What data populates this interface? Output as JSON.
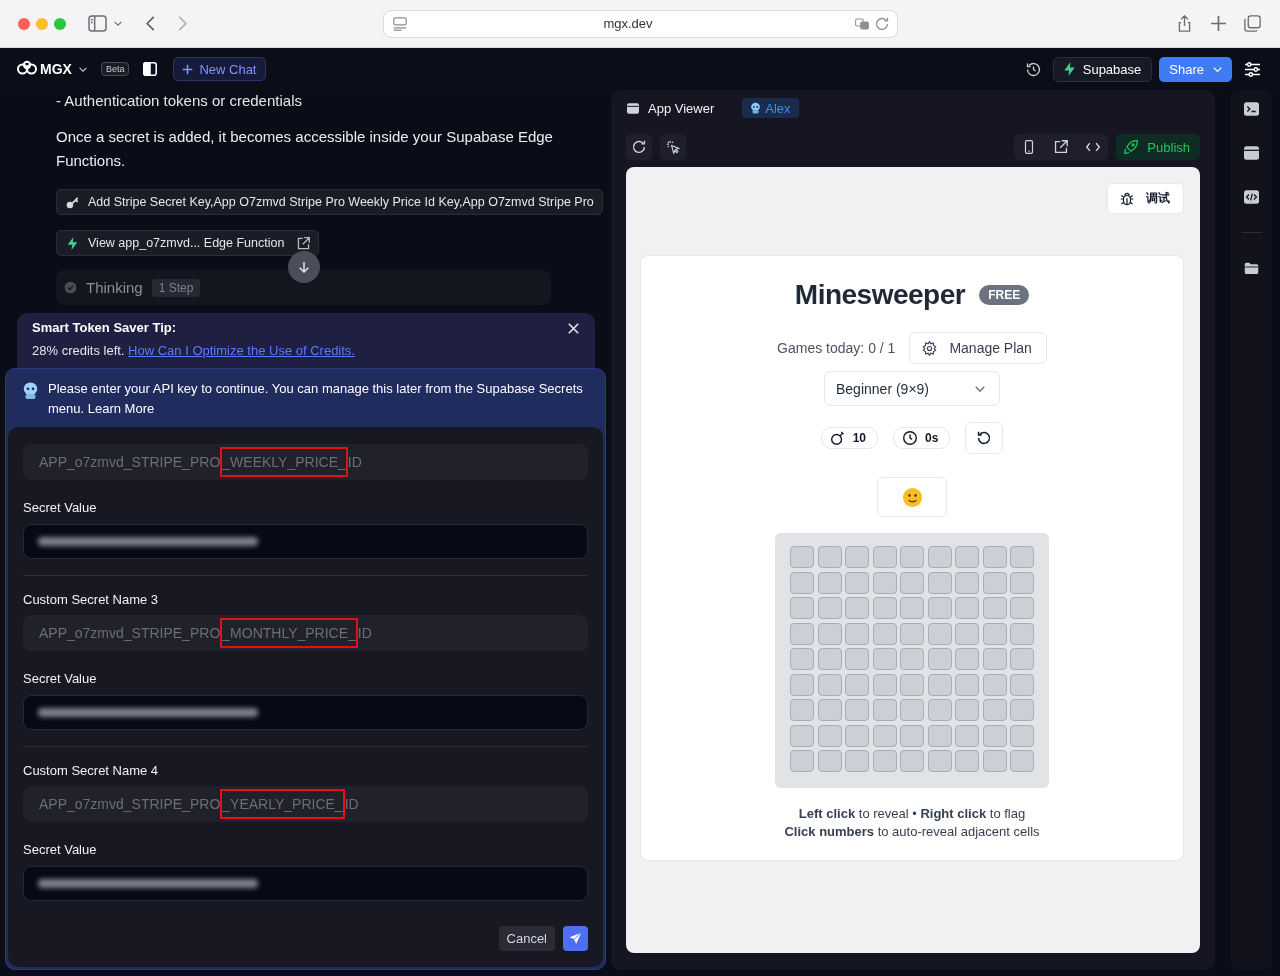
{
  "browser": {
    "url": "mgx.dev"
  },
  "header": {
    "logo": "MGX",
    "badge": "Beta",
    "new_chat": "New Chat",
    "supabase": "Supabase",
    "share": "Share"
  },
  "chat": {
    "clipped_line": "- Authentication tokens or credentials",
    "paragraph": "Once a secret is added, it becomes accessible inside your Supabase Edge Functions.",
    "actions": [
      {
        "kind": "secret",
        "label": "Add Stripe Secret Key,App O7zmvd Stripe Pro Weekly Price Id Key,App O7zmvd Stripe Pro"
      },
      {
        "kind": "function",
        "label": "View app_o7zmvd... Edge Function"
      }
    ],
    "thinking": {
      "label": "Thinking",
      "steps": "1 Step"
    }
  },
  "tip": {
    "title": "Smart Token Saver Tip:",
    "text": "28% credits left.",
    "link": "How Can I Optimize the Use of Credits."
  },
  "secrets_form": {
    "message": "Please enter your API key to continue. You can manage this later from the Supabase Secrets menu.",
    "link": "Learn More",
    "secrets": [
      {
        "name": [
          {
            "text": "APP_o7zmvd_STRIPE_PRO",
            "highlighted": false
          },
          {
            "text": "_WEEKLY_PRICE_",
            "highlighted": true
          },
          {
            "text": "ID",
            "highlighted": false
          }
        ],
        "disabled": true,
        "value_label": "Secret Value"
      },
      {
        "name_label": "Custom Secret Name 3",
        "name": [
          {
            "text": "APP_o7zmvd_STRIPE_PRO",
            "highlighted": false
          },
          {
            "text": "_MONTHLY_PRICE_",
            "highlighted": true
          },
          {
            "text": "ID",
            "highlighted": false
          }
        ],
        "disabled": true,
        "value_label": "Secret Value"
      },
      {
        "name_label": "Custom Secret Name 4",
        "name": [
          {
            "text": "APP_o7zmvd_STRIPE_PRO",
            "highlighted": false
          },
          {
            "text": "_YEARLY_PRICE_",
            "highlighted": true
          },
          {
            "text": "ID",
            "highlighted": false
          }
        ],
        "disabled": true,
        "value_label": "Secret Value"
      }
    ],
    "cancel": "Cancel"
  },
  "viewer": {
    "title": "App Viewer",
    "agent": "Alex",
    "publish": "Publish",
    "debug": "调试"
  },
  "game": {
    "title": "Minesweeper",
    "plan_badge": "FREE",
    "games_today": "Games today: 0 / 1",
    "manage_plan": "Manage Plan",
    "difficulty": "Beginner (9×9)",
    "mines": "10",
    "timer": "0s",
    "cells": [
      [
        {
          "revealed": false
        },
        {
          "revealed": false
        },
        {
          "revealed": false
        },
        {
          "revealed": false
        },
        {
          "revealed": false
        },
        {
          "revealed": false
        },
        {
          "revealed": false
        },
        {
          "revealed": false
        },
        {
          "revealed": false
        }
      ],
      [
        {
          "revealed": false
        },
        {
          "revealed": false
        },
        {
          "revealed": false
        },
        {
          "revealed": false
        },
        {
          "revealed": false
        },
        {
          "revealed": false
        },
        {
          "revealed": false
        },
        {
          "revealed": false
        },
        {
          "revealed": false
        }
      ],
      [
        {
          "revealed": false
        },
        {
          "revealed": false
        },
        {
          "revealed": false
        },
        {
          "revealed": false
        },
        {
          "revealed": false
        },
        {
          "revealed": false
        },
        {
          "revealed": false
        },
        {
          "revealed": false
        },
        {
          "revealed": false
        }
      ],
      [
        {
          "revealed": false
        },
        {
          "revealed": false
        },
        {
          "revealed": false
        },
        {
          "revealed": false
        },
        {
          "revealed": false
        },
        {
          "revealed": false
        },
        {
          "revealed": false
        },
        {
          "revealed": false
        },
        {
          "revealed": false
        }
      ],
      [
        {
          "revealed": false
        },
        {
          "revealed": false
        },
        {
          "revealed": false
        },
        {
          "revealed": false
        },
        {
          "revealed": false
        },
        {
          "revealed": false
        },
        {
          "revealed": false
        },
        {
          "revealed": false
        },
        {
          "revealed": false
        }
      ],
      [
        {
          "revealed": false
        },
        {
          "revealed": false
        },
        {
          "revealed": false
        },
        {
          "revealed": false
        },
        {
          "revealed": false
        },
        {
          "revealed": false
        },
        {
          "revealed": false
        },
        {
          "revealed": false
        },
        {
          "revealed": false
        }
      ],
      [
        {
          "revealed": false
        },
        {
          "revealed": false
        },
        {
          "revealed": false
        },
        {
          "revealed": false
        },
        {
          "revealed": false
        },
        {
          "revealed": false
        },
        {
          "revealed": false
        },
        {
          "revealed": false
        },
        {
          "revealed": false
        }
      ],
      [
        {
          "revealed": false
        },
        {
          "revealed": false
        },
        {
          "revealed": false
        },
        {
          "revealed": false
        },
        {
          "revealed": false
        },
        {
          "revealed": false
        },
        {
          "revealed": false
        },
        {
          "revealed": false
        },
        {
          "revealed": false
        }
      ],
      [
        {
          "revealed": false
        },
        {
          "revealed": false
        },
        {
          "revealed": false
        },
        {
          "revealed": false
        },
        {
          "revealed": false
        },
        {
          "revealed": false
        },
        {
          "revealed": false
        },
        {
          "revealed": false
        },
        {
          "revealed": false
        }
      ]
    ],
    "help": [
      "**Left click** to reveal • **Right click** to flag",
      "**Click numbers** to auto-reveal adjacent cells"
    ]
  }
}
